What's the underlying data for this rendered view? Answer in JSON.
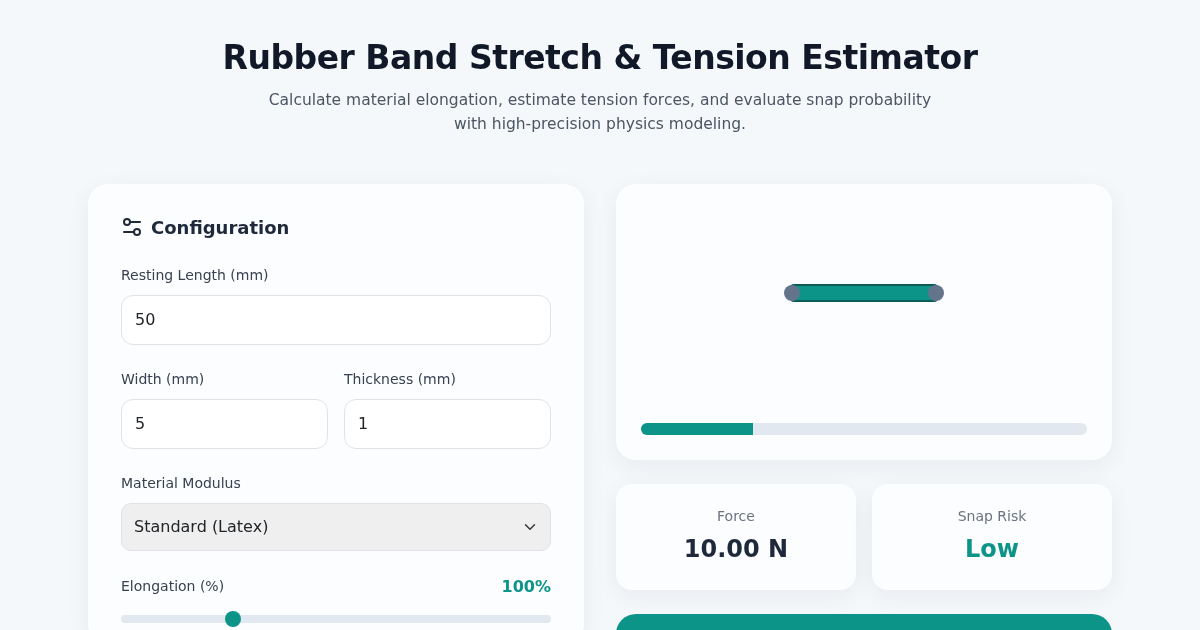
{
  "header": {
    "title": "Rubber Band Stretch & Tension Estimator",
    "subtitle": "Calculate material elongation, estimate tension forces, and evaluate snap probability with high-precision physics modeling."
  },
  "config": {
    "title": "Configuration",
    "fields": [
      {
        "label": "Resting Length (mm)",
        "value": "50"
      },
      {
        "label": "Width (mm)",
        "value": "5"
      },
      {
        "label": "Thickness (mm)",
        "value": "1"
      }
    ],
    "material": {
      "label": "Material Modulus",
      "value": "Standard (Latex)"
    },
    "elongation": {
      "label": "Elongation (%)",
      "reading": "100%",
      "level": 0.26
    }
  },
  "preview": {
    "stretch_bar": {
      "level": 0.25
    }
  },
  "stats": [
    {
      "label": "Force",
      "value": "10.00 N",
      "color": "#1e293b"
    },
    {
      "label": "Snap Risk",
      "value": "Low",
      "color": "#0d9488"
    }
  ]
}
